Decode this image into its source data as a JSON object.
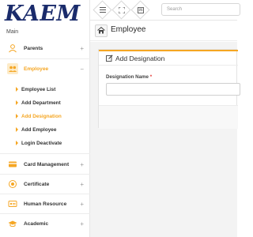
{
  "brand": {
    "logo": "KAEM"
  },
  "sidebar": {
    "section_label": "Main",
    "items": [
      {
        "label": "Parents",
        "sign": "+"
      },
      {
        "label": "Employee",
        "sign": "−",
        "active": true
      },
      {
        "label": "Card Management",
        "sign": "+"
      },
      {
        "label": "Certificate",
        "sign": "+"
      },
      {
        "label": "Human Resource",
        "sign": "+"
      },
      {
        "label": "Academic",
        "sign": "+"
      }
    ],
    "employee_submenu": [
      {
        "label": "Employee List"
      },
      {
        "label": "Add Department"
      },
      {
        "label": "Add Designation",
        "active": true
      },
      {
        "label": "Add Employee"
      },
      {
        "label": "Login Deactivate"
      }
    ]
  },
  "topbar": {
    "menu_icon": "menu-icon",
    "fullscreen_icon": "fullscreen-icon",
    "calculator_icon": "calculator-icon",
    "search_placeholder": "Search"
  },
  "breadcrumb": {
    "title": "Employee"
  },
  "form": {
    "title": "Add Designation",
    "designation_label": "Designation Name",
    "required_mark": "*",
    "designation_value": ""
  },
  "colors": {
    "accent": "#f5a623",
    "brand": "#1a2b6b",
    "required": "#e53935"
  }
}
